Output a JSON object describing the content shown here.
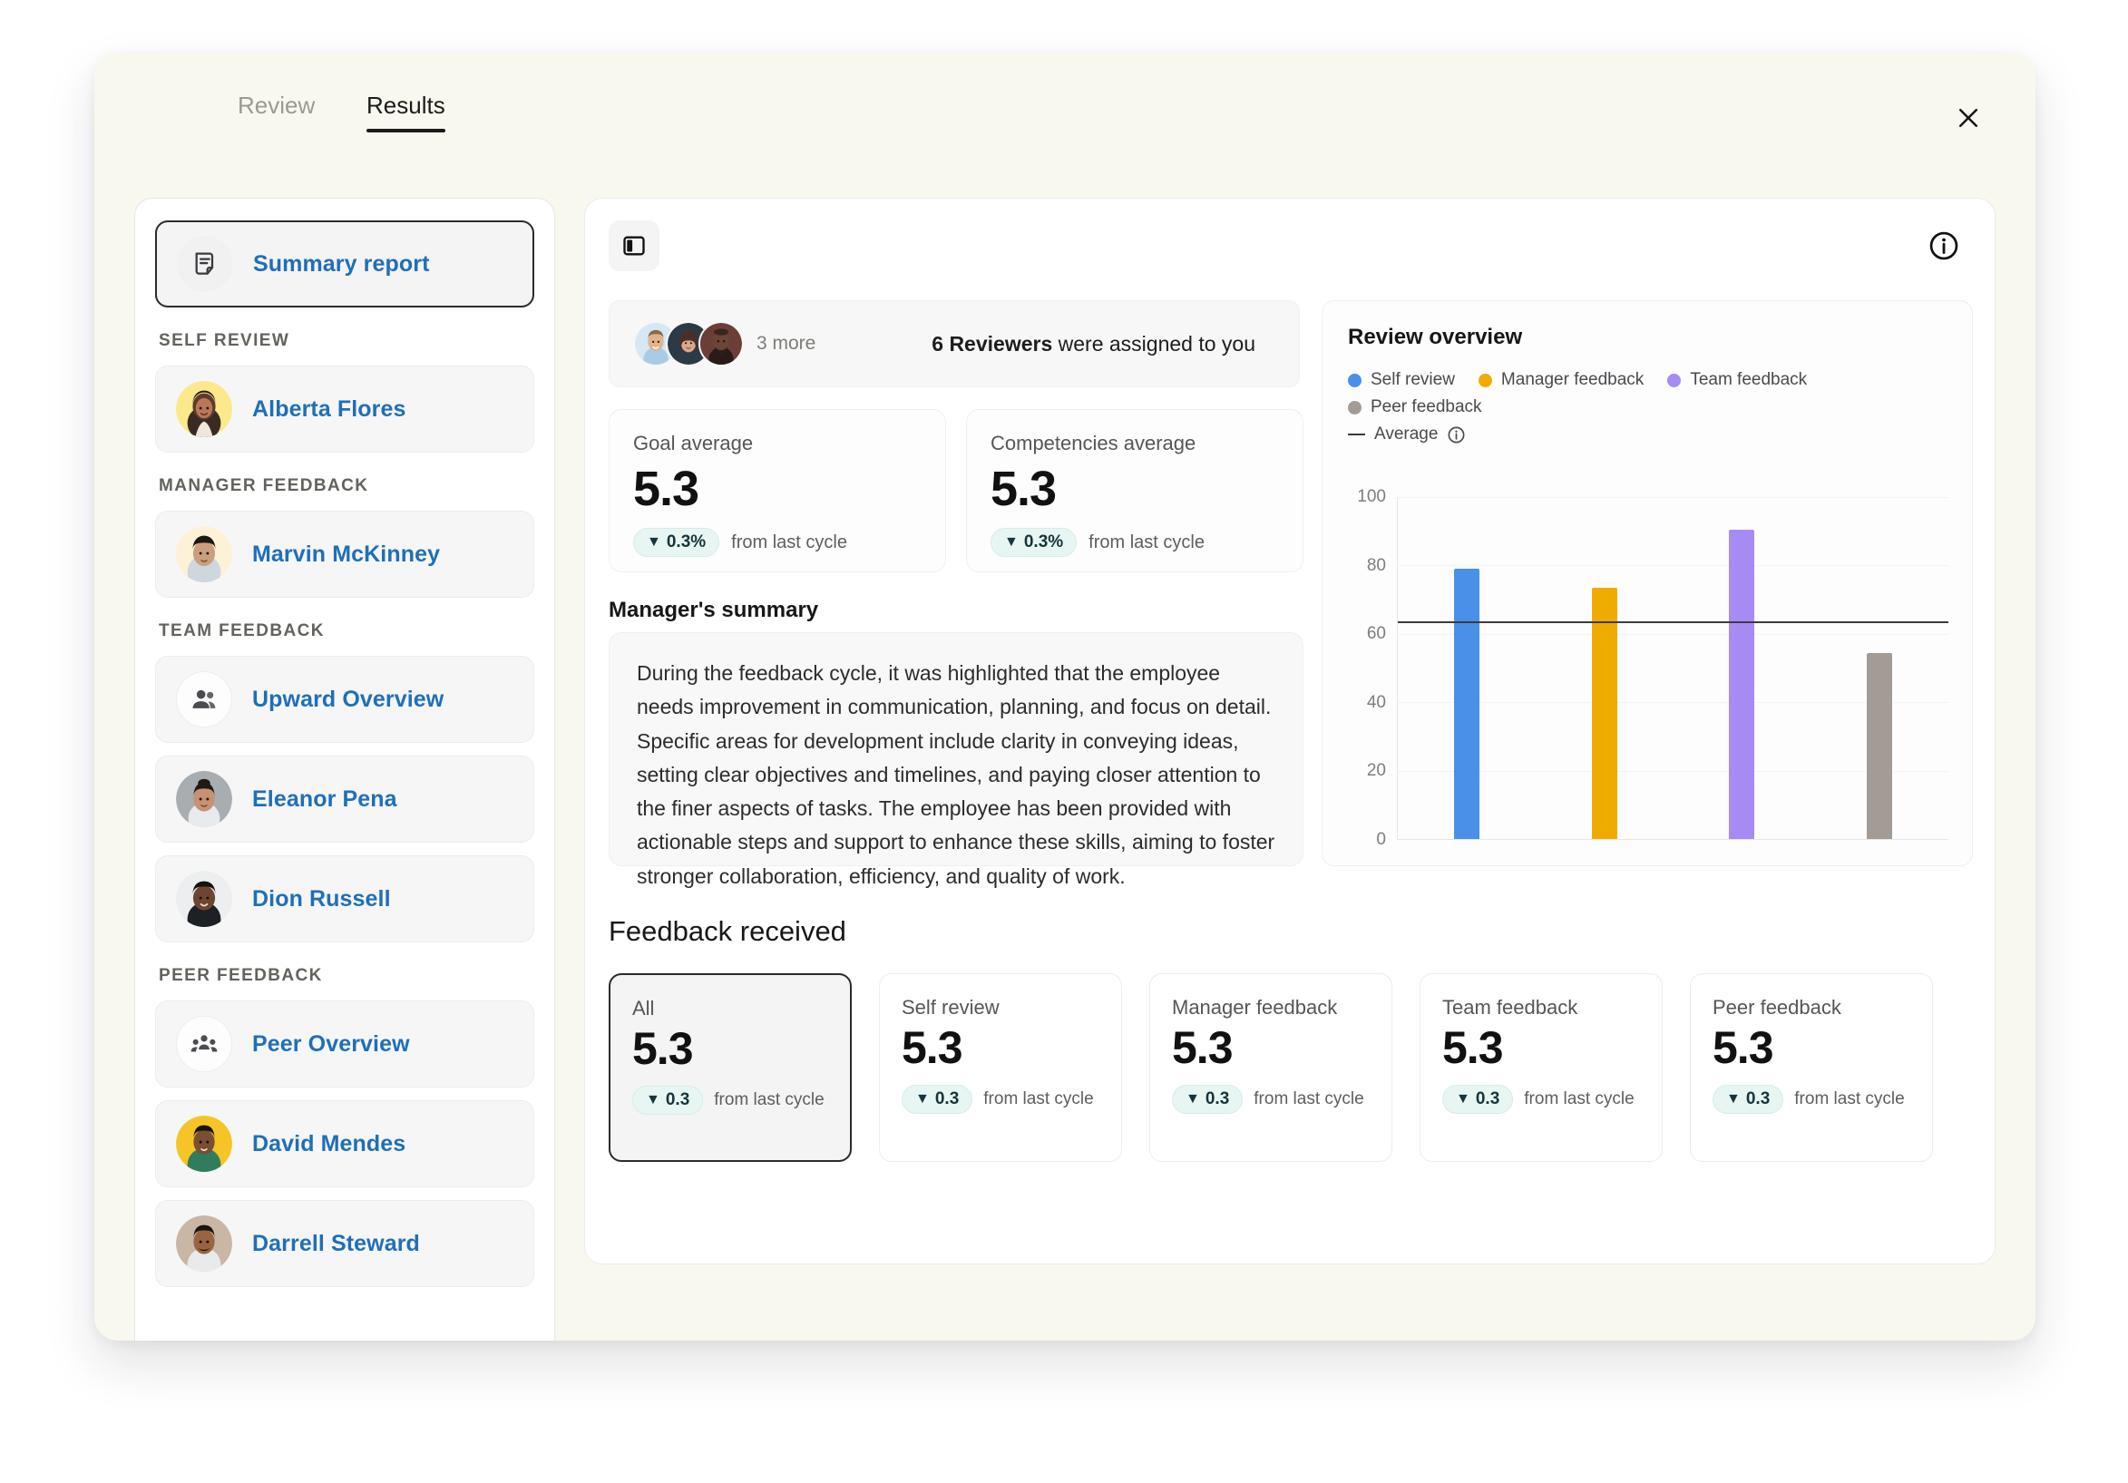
{
  "tabs": [
    {
      "label": "Review",
      "active": false
    },
    {
      "label": "Results",
      "active": true
    }
  ],
  "close_icon": "close-icon",
  "sidebar": {
    "summary": {
      "label": "Summary report",
      "icon": "document-note-icon"
    },
    "sections": [
      {
        "heading": "SELF REVIEW",
        "items": [
          {
            "label": "Alberta Flores",
            "kind": "avatar",
            "avatar": "alberta-flores"
          }
        ]
      },
      {
        "heading": "MANAGER FEEDBACK",
        "items": [
          {
            "label": "Marvin McKinney",
            "kind": "avatar",
            "avatar": "marvin-mckinney"
          }
        ]
      },
      {
        "heading": "TEAM FEEDBACK",
        "items": [
          {
            "label": "Upward Overview",
            "kind": "icon",
            "icon": "two-people-icon"
          },
          {
            "label": "Eleanor Pena",
            "kind": "avatar",
            "avatar": "eleanor-pena"
          },
          {
            "label": "Dion Russell",
            "kind": "avatar",
            "avatar": "dion-russell"
          }
        ]
      },
      {
        "heading": "PEER FEEDBACK",
        "items": [
          {
            "label": "Peer Overview",
            "kind": "icon",
            "icon": "three-people-icon"
          },
          {
            "label": "David Mendes",
            "kind": "avatar",
            "avatar": "david-mendes"
          },
          {
            "label": "Darrell Steward",
            "kind": "avatar",
            "avatar": "darrell-steward"
          }
        ]
      }
    ]
  },
  "main": {
    "panel_toggle_icon": "sidebar-panel-icon",
    "info_icon": "info-circle-icon",
    "reviewers": {
      "more_text": "3 more",
      "count_text": "6 Reviewers",
      "sentence_rest": "were assigned to you"
    },
    "metrics": [
      {
        "title": "Goal average",
        "value": "5.3",
        "delta": "0.3%",
        "delta_direction": "down",
        "delta_sub": "from last cycle"
      },
      {
        "title": "Competencies average",
        "value": "5.3",
        "delta": "0.3%",
        "delta_direction": "down",
        "delta_sub": "from last cycle"
      }
    ],
    "summary": {
      "title": "Manager's summary",
      "text": "During the feedback cycle, it was highlighted that the employee needs improvement in communication, planning, and focus on detail. Specific areas for development include clarity in conveying ideas, setting clear objectives and timelines, and paying closer attention to the finer aspects of tasks. The employee has been provided with actionable steps and support to enhance these skills, aiming to foster stronger collaboration, efficiency, and quality of work."
    },
    "feedback_received": {
      "title": "Feedback received",
      "cards": [
        {
          "label": "All",
          "value": "5.3",
          "delta": "0.3",
          "delta_sub": "from last cycle",
          "selected": true
        },
        {
          "label": "Self review",
          "value": "5.3",
          "delta": "0.3",
          "delta_sub": "from last cycle",
          "selected": false
        },
        {
          "label": "Manager feedback",
          "value": "5.3",
          "delta": "0.3",
          "delta_sub": "from last cycle",
          "selected": false
        },
        {
          "label": "Team feedback",
          "value": "5.3",
          "delta": "0.3",
          "delta_sub": "from last cycle",
          "selected": false
        },
        {
          "label": "Peer feedback",
          "value": "5.3",
          "delta": "0.3",
          "delta_sub": "from last cycle",
          "selected": false
        }
      ]
    }
  },
  "chart_data": {
    "type": "bar",
    "title": "Review overview",
    "categories": [
      "Self review",
      "Manager feedback",
      "Team feedback",
      "Peer feedback"
    ],
    "values": [
      79,
      73.5,
      90.5,
      54.5
    ],
    "colors": [
      "#4a90e8",
      "#efab00",
      "#a78bf5",
      "#a39b95"
    ],
    "average": 63.5,
    "average_label": "Average",
    "average_color": "#3c3c3c",
    "xlabel": "",
    "ylabel": "",
    "ylim": [
      0,
      100
    ],
    "yticks": [
      0,
      20,
      40,
      60,
      80,
      100
    ],
    "grid": true,
    "legend_position": "top",
    "legend": [
      {
        "name": "Self review",
        "color": "#4a90e8",
        "marker": "dot"
      },
      {
        "name": "Manager feedback",
        "color": "#efab00",
        "marker": "dot"
      },
      {
        "name": "Team feedback",
        "color": "#a78bf5",
        "marker": "dot"
      },
      {
        "name": "Peer feedback",
        "color": "#a39b95",
        "marker": "dot"
      },
      {
        "name": "Average",
        "color": "#3c3c3c",
        "marker": "line"
      }
    ]
  }
}
